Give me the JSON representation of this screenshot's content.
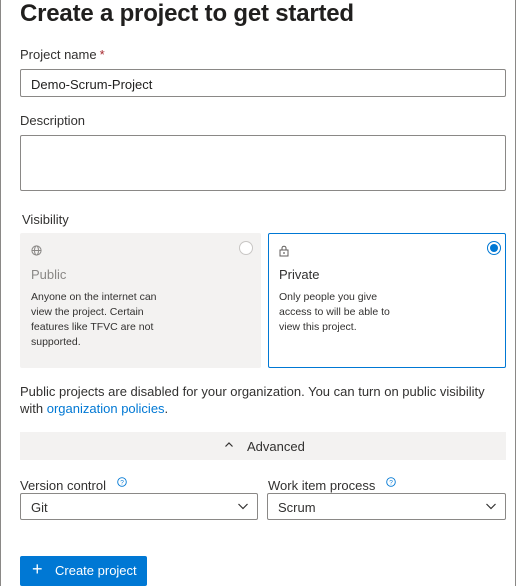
{
  "page": {
    "title": "Create a project to get started"
  },
  "project_name": {
    "label": "Project name",
    "required_mark": "*",
    "value": "Demo-Scrum-Project"
  },
  "description": {
    "label": "Description",
    "value": ""
  },
  "visibility": {
    "label": "Visibility",
    "options": [
      {
        "icon": "globe-icon",
        "name": "Public",
        "description": "Anyone on the internet can view the project. Certain features like TFVC are not supported.",
        "selected": false,
        "disabled": true
      },
      {
        "icon": "lock-icon",
        "name": "Private",
        "description": "Only people you give access to will be able to view this project.",
        "selected": true,
        "disabled": false
      }
    ],
    "disabled_note": "Public projects are disabled for your organization. You can turn on public visibility with",
    "link_text": "organization policies",
    "note_end": "."
  },
  "advanced": {
    "label": "Advanced",
    "chevron": "^"
  },
  "version_control": {
    "label": "Version control",
    "value": "Git"
  },
  "work_item_process": {
    "label": "Work item process",
    "value": "Scrum"
  },
  "create_button": {
    "label": "Create project",
    "icon": "+"
  },
  "colors": {
    "accent": "#0078d4",
    "required": "#a4262c",
    "panel": "#f3f2f1"
  }
}
